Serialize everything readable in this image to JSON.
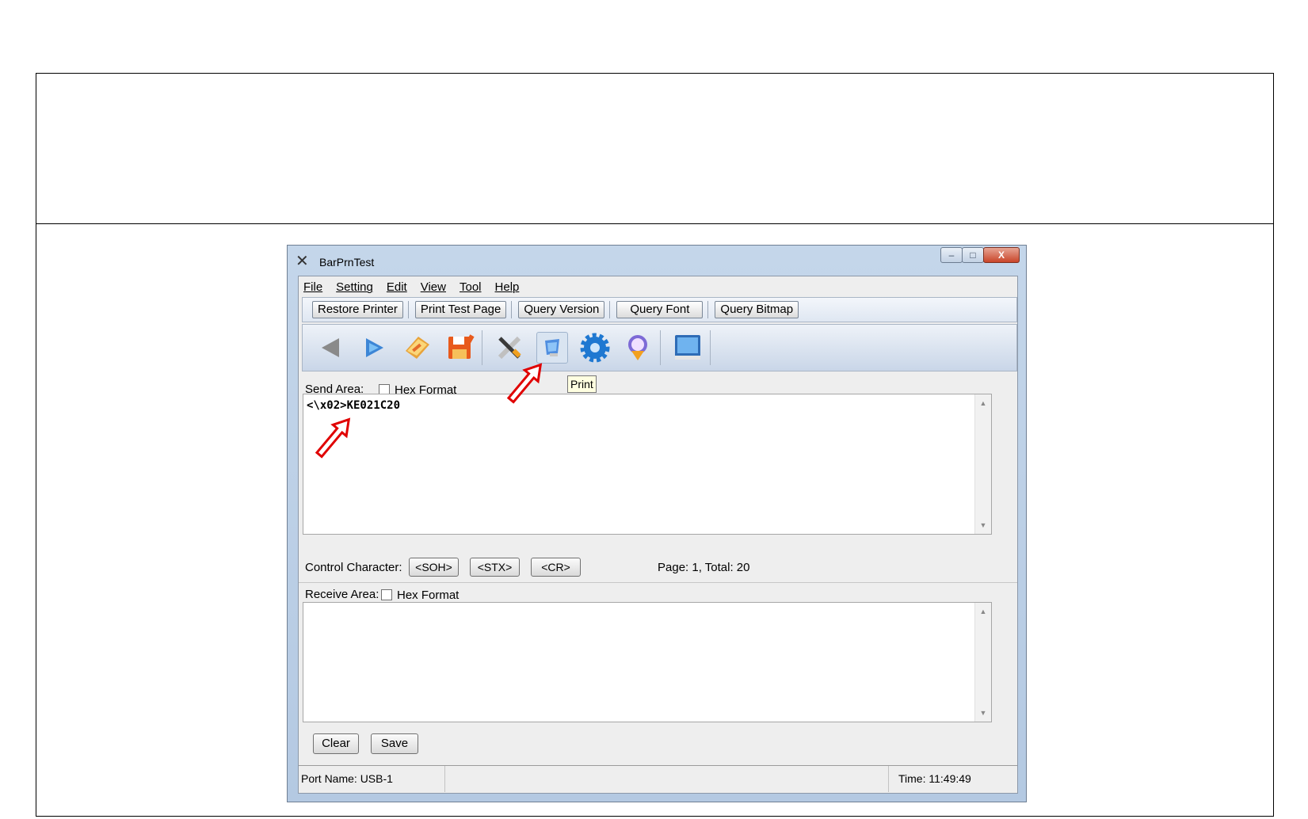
{
  "window": {
    "title": "BarPrnTest",
    "controls": {
      "minimize": "–",
      "maximize": "□",
      "close": "X"
    }
  },
  "menu": [
    "File",
    "Setting",
    "Edit",
    "View",
    "Tool",
    "Help"
  ],
  "toolbar_buttons": [
    "Restore Printer",
    "Print Test Page",
    "Query Version",
    "Query Font",
    "Query Bitmap"
  ],
  "toolbar_icons": [
    "back-icon",
    "forward-icon",
    "open-icon",
    "save-icon",
    "tools-icon",
    "print-icon",
    "settings-icon",
    "download-icon",
    "monitor-icon"
  ],
  "tooltip": "Print",
  "send_area": {
    "label": "Send Area:",
    "hex_format_label": "Hex Format",
    "hex_checked": false,
    "content": "<\\x02>KE021C20"
  },
  "control_characters": {
    "label": "Control Character:",
    "buttons": [
      "<SOH>",
      "<STX>",
      "<CR>"
    ]
  },
  "page_info": "Page: 1, Total: 20",
  "receive_area": {
    "label": "Receive Area:",
    "hex_format_label": "Hex Format",
    "hex_checked": false,
    "content": ""
  },
  "buttons": {
    "clear": "Clear",
    "save": "Save"
  },
  "status": {
    "port": "Port Name: USB-1",
    "time": "Time: 11:49:49"
  },
  "colors": {
    "annotation_arrow": "#e00000",
    "title_bar": "#c4d6ea",
    "tooltip_bg": "#ffffe1"
  }
}
